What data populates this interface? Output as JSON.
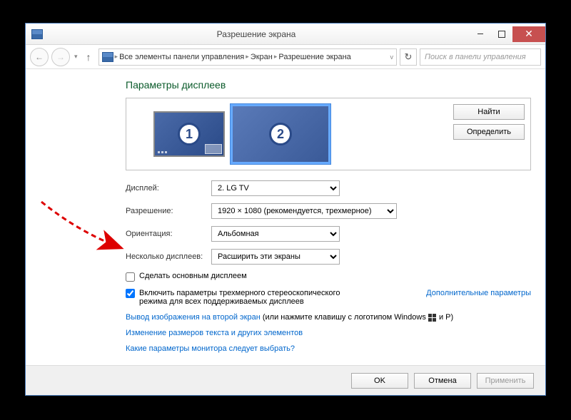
{
  "window": {
    "title": "Разрешение экрана"
  },
  "breadcrumb": {
    "item1": "Все элементы панели управления",
    "item2": "Экран",
    "item3": "Разрешение экрана"
  },
  "search": {
    "placeholder": "Поиск в панели управления"
  },
  "heading": "Параметры дисплеев",
  "preview_buttons": {
    "find": "Найти",
    "identify": "Определить"
  },
  "monitors": {
    "m1": "1",
    "m2": "2"
  },
  "form": {
    "display_label": "Дисплей:",
    "display_value": "2. LG TV",
    "resolution_label": "Разрешение:",
    "resolution_value": "1920 × 1080 (рекомендуется, трехмерное)",
    "orientation_label": "Ориентация:",
    "orientation_value": "Альбомная",
    "multiple_label": "Несколько дисплеев:",
    "multiple_value": "Расширить эти экраны"
  },
  "checkboxes": {
    "make_primary": "Сделать основным дисплеем",
    "stereo_3d": "Включить параметры трехмерного стереоскопического режима для всех поддерживаемых дисплеев"
  },
  "links": {
    "advanced": "Дополнительные параметры",
    "second_screen_prefix": "Вывод изображения на второй экран",
    "second_screen_suffix": " (или нажмите клавишу с логотипом Windows ",
    "second_screen_key": " и P)",
    "text_size": "Изменение размеров текста и других элементов",
    "which_monitor": "Какие параметры монитора следует выбрать?"
  },
  "footer": {
    "ok": "OK",
    "cancel": "Отмена",
    "apply": "Применить"
  }
}
